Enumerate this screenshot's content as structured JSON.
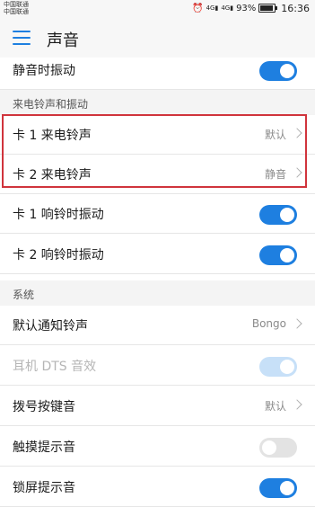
{
  "status_bar": {
    "carrier_1": "中国联通",
    "carrier_2": "中国联通",
    "network_1": "4G",
    "network_2": "4G",
    "battery": "93%",
    "battery_level": 0.93,
    "time": "16:36"
  },
  "app_bar": {
    "title": "声音"
  },
  "rows": {
    "silent_vibrate": {
      "label": "静音时振动",
      "on": true
    },
    "card1_ringtone": {
      "label": "卡 1 来电铃声",
      "value": "默认"
    },
    "card2_ringtone": {
      "label": "卡 2 来电铃声",
      "value": "静音"
    },
    "card1_vibrate": {
      "label": "卡 1 响铃时振动",
      "on": true
    },
    "card2_vibrate": {
      "label": "卡 2 响铃时振动",
      "on": true
    },
    "notification_tone": {
      "label": "默认通知铃声",
      "value": "Bongo"
    },
    "dts_effect": {
      "label": "耳机 DTS 音效",
      "on": true,
      "disabled": true
    },
    "dial_tone": {
      "label": "拨号按键音",
      "value": "默认"
    },
    "touch_tone": {
      "label": "触摸提示音",
      "on": false
    },
    "lock_tone": {
      "label": "锁屏提示音",
      "on": true
    }
  },
  "sections": {
    "ringtone_vibration": "来电铃声和振动",
    "system": "系统"
  },
  "colors": {
    "accent": "#1e7fe0",
    "highlight": "#d0343c"
  }
}
